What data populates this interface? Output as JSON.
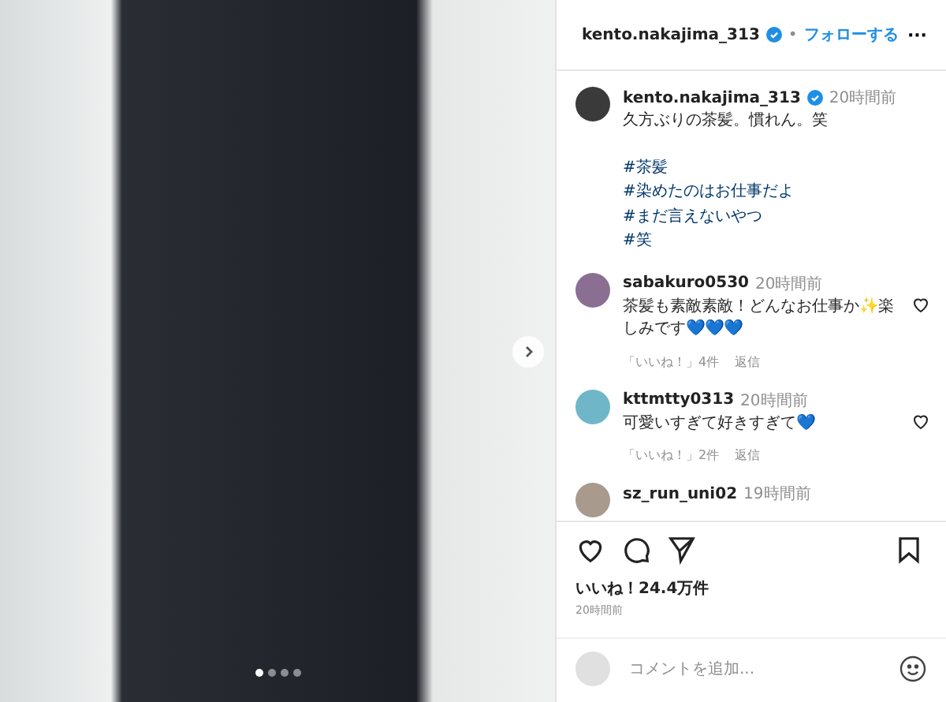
{
  "media": {
    "dots": [
      {
        "selected": true
      },
      {
        "selected": false
      },
      {
        "selected": false
      },
      {
        "selected": false
      }
    ]
  },
  "header": {
    "username": "kento.nakajima_313",
    "separator": "•",
    "follow": "フォローする",
    "more": "···"
  },
  "caption": {
    "username": "kento.nakajima_313",
    "time": "20時間前",
    "text": "久方ぶりの茶髪。慣れん。笑",
    "tags": [
      "#茶髪",
      "#染めたのはお仕事だよ",
      "#まだ言えないやつ",
      "#笑"
    ]
  },
  "comments": [
    {
      "username": "sabakuro0530",
      "time": "20時間前",
      "text": "茶髪も素敵素敵！どんなお仕事か✨楽しみです💙💙💙",
      "likes": "「いいね！」4件",
      "reply": "返信",
      "color": "#8a6f92"
    },
    {
      "username": "kttmtty0313",
      "time": "20時間前",
      "text": "可愛いすぎて好きすぎて💙",
      "likes": "「いいね！」2件",
      "reply": "返信",
      "color": "#6fb6c8"
    },
    {
      "username": "sz_run_uni02",
      "time": "19時間前",
      "color": "#a89a8c"
    }
  ],
  "likes": "いいね！24.4万件",
  "posted": "20時間前",
  "comment_input": {
    "placeholder": "コメントを追加..."
  }
}
